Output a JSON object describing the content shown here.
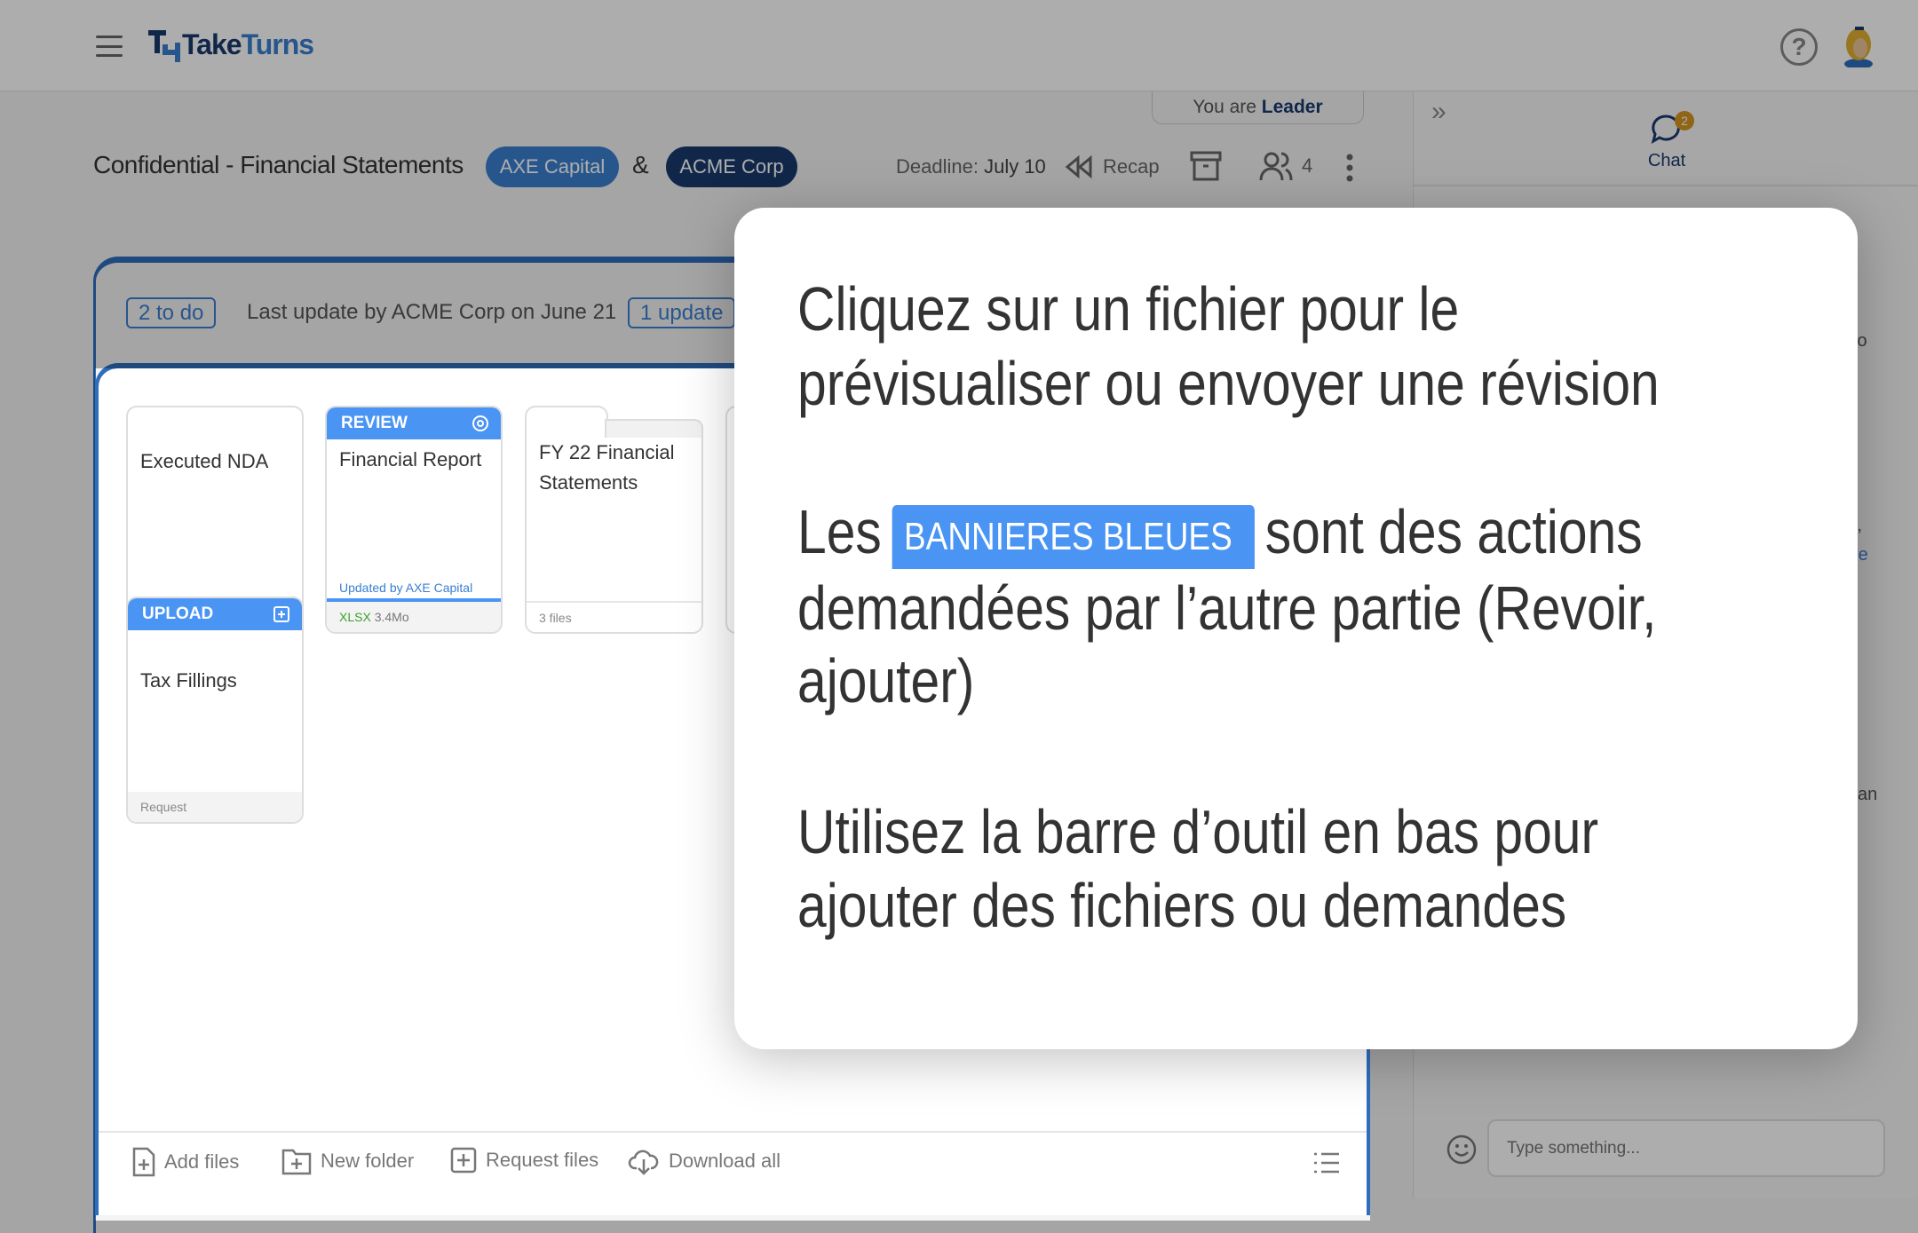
{
  "header": {
    "logo_part1": "Take",
    "logo_part2": "Turns",
    "help_icon": "help-circle-icon",
    "avatar_icon": "user-avatar"
  },
  "role": {
    "prefix": "You are",
    "value": "Leader"
  },
  "deal": {
    "title": "Confidential - Financial Statements",
    "party_a": "AXE Capital",
    "party_b": "ACME Corp",
    "ampersand": "&"
  },
  "toolbar": {
    "deadline_label": "Deadline:",
    "deadline_value": "July 10",
    "recap": "Recap",
    "members_count": "4"
  },
  "status": {
    "todo": "2 to do",
    "last_update": "Last update by ACME Corp on June 21",
    "updates": "1 update"
  },
  "files": [
    {
      "name": "Executed NDA"
    },
    {
      "banner": "UPLOAD",
      "name": "Tax Fillings",
      "footer": "Request"
    },
    {
      "banner": "REVIEW",
      "name": "Financial Report",
      "updated": "Updated by AXE Capital",
      "type": "XLSX",
      "size": "3.4Mo"
    },
    {
      "name_line1": "FY 22 Financial",
      "name_line2": "Statements",
      "footer": "3 files"
    }
  ],
  "bottom_toolbar": {
    "add_files": "Add files",
    "new_folder": "New folder",
    "request_files": "Request files",
    "download_all": "Download all"
  },
  "chat": {
    "collapse": "»",
    "label": "Chat",
    "badge": "2",
    "placeholder": "Type something...",
    "fragments": [
      "to",
      "t,",
      "re",
      "an"
    ]
  },
  "modal": {
    "p1": [
      "Cliquez sur un fichier pour le",
      "prévisualiser ou envoyer une révision"
    ],
    "p2_start": "Les",
    "banner": "BANNIERES BLEUES",
    "p2_end": "sont des actions",
    "p2": [
      "demandées par l’autre partie (Revoir,",
      "ajouter)"
    ],
    "p3": [
      "Utilisez la barre d’outil en bas pour",
      "ajouter des fichiers ou demandes"
    ]
  },
  "colors": {
    "accent": "#4a94f4",
    "brand_dark": "#1a3a6e",
    "brand": "#2f6dbd",
    "badge": "#d4961f",
    "xlsx": "#3aa02c"
  }
}
